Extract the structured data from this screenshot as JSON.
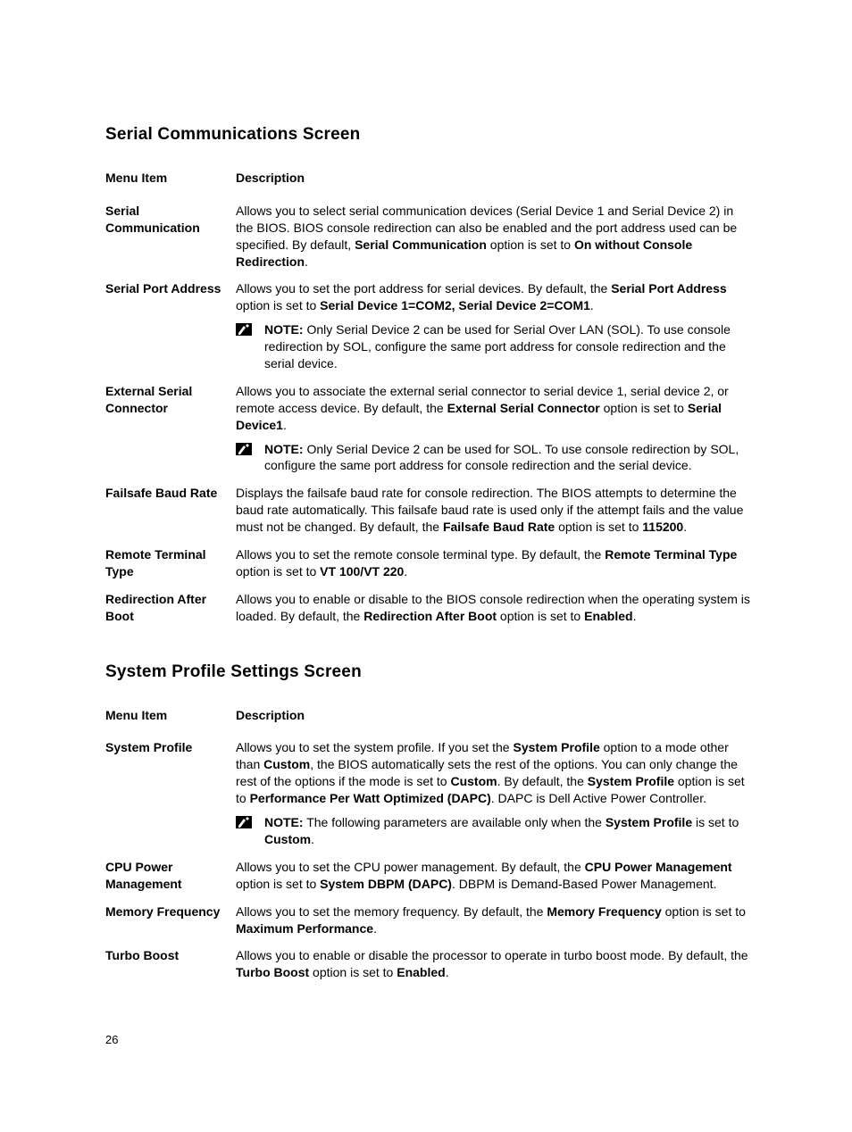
{
  "section1": {
    "title": "Serial Communications Screen",
    "col1": "Menu Item",
    "col2": "Description",
    "rows": {
      "r0": {
        "mi": "Serial Communication",
        "d1": "Allows you to select serial communication devices (Serial Device 1 and Serial Device 2) in the BIOS. BIOS console redirection can also be enabled and the port address used can be specified. By default, ",
        "b1": "Serial Communication",
        "d2": " option is set to ",
        "b2": "On without Console Redirection",
        "d3": "."
      },
      "r1": {
        "mi": "Serial Port Address",
        "d1": "Allows you to set the port address for serial devices. By default, the ",
        "b1": "Serial Port Address",
        "d2": " option is set to ",
        "b2": "Serial Device 1=COM2, Serial Device 2=COM1",
        "d3": ".",
        "note_b": "NOTE:",
        "note_t": " Only Serial Device 2 can be used for Serial Over LAN (SOL). To use console redirection by SOL, configure the same port address for console redirection and the serial device."
      },
      "r2": {
        "mi": "External Serial Connector",
        "d1": "Allows you to associate the external serial connector to serial device 1, serial device 2, or remote access device. By default, the ",
        "b1": "External Serial Connector",
        "d2": " option is set to ",
        "b2": "Serial Device1",
        "d3": ".",
        "note_b": "NOTE:",
        "note_t": " Only Serial Device 2 can be used for SOL. To use console redirection by SOL, configure the same port address for console redirection and the serial device."
      },
      "r3": {
        "mi": "Failsafe Baud Rate",
        "d1": "Displays the failsafe baud rate for console redirection. The BIOS attempts to determine the baud rate automatically. This failsafe baud rate is used only if the attempt fails and the value must not be changed. By default, the ",
        "b1": "Failsafe Baud Rate",
        "d2": " option is set to ",
        "b2": "115200",
        "d3": "."
      },
      "r4": {
        "mi": "Remote Terminal Type",
        "d1": "Allows you to set the remote console terminal type. By default, the ",
        "b1": "Remote Terminal Type",
        "d2": " option is set to ",
        "b2": "VT 100/VT 220",
        "d3": "."
      },
      "r5": {
        "mi": "Redirection After Boot",
        "d1": "Allows you to enable or disable to the BIOS console redirection when the operating system is loaded. By default, the ",
        "b1": "Redirection After Boot",
        "d2": " option is set to ",
        "b2": "Enabled",
        "d3": "."
      }
    }
  },
  "section2": {
    "title": "System Profile Settings Screen",
    "col1": "Menu Item",
    "col2": "Description",
    "rows": {
      "r0": {
        "mi": "System Profile",
        "d1": "Allows you to set the system profile. If you set the ",
        "b1": "System Profile",
        "d2": " option to a mode other than ",
        "b2": "Custom",
        "d3": ", the BIOS automatically sets the rest of the options. You can only change the rest of the options if the mode is set to ",
        "b3": "Custom",
        "d4": ". By default, the ",
        "b4": "System Profile",
        "d5": " option is set to ",
        "b5": "Performance Per Watt Optimized (DAPC)",
        "d6": ". DAPC is Dell Active Power Controller.",
        "note_b": "NOTE:",
        "note_t1": " The following parameters are available only when the ",
        "note_b2": "System Profile",
        "note_t2": " is set to ",
        "note_b3": "Custom",
        "note_t3": "."
      },
      "r1": {
        "mi": "CPU Power Management",
        "d1": "Allows you to set the CPU power management. By default, the ",
        "b1": "CPU Power Management",
        "d2": " option is set to ",
        "b2": "System DBPM (DAPC)",
        "d3": ". DBPM is Demand-Based Power Management."
      },
      "r2": {
        "mi": "Memory Frequency",
        "d1": "Allows you to set the memory frequency. By default, the ",
        "b1": "Memory Frequency",
        "d2": " option is set to ",
        "b2": "Maximum Performance",
        "d3": "."
      },
      "r3": {
        "mi": "Turbo Boost",
        "d1": "Allows you to enable or disable the processor to operate in turbo boost mode. By default, the ",
        "b1": "Turbo Boost",
        "d2": " option is set to ",
        "b2": "Enabled",
        "d3": "."
      }
    }
  },
  "pageNumber": "26"
}
